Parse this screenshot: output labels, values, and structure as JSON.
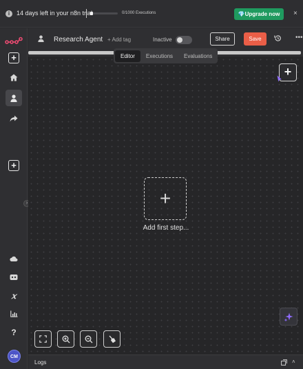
{
  "banner": {
    "trial_text": "14 days left in your n8n trial",
    "executions_text": "0/1000 Executions",
    "executions_used": 0,
    "executions_limit": 1000,
    "upgrade_label": "💎Upgrade now",
    "info_glyph": "i",
    "close_glyph": "×"
  },
  "header": {
    "workflow_name": "Research Agent",
    "add_tag_label": "+ Add tag",
    "active_label": "Inactive",
    "active": false,
    "share_label": "Share",
    "save_label": "Save",
    "more_glyph": "•••"
  },
  "tabs": [
    {
      "label": "Editor",
      "active": true
    },
    {
      "label": "Executions",
      "active": false
    },
    {
      "label": "Evaluations",
      "active": false
    }
  ],
  "canvas": {
    "add_node_glyph": "+",
    "first_step_glyph": "+",
    "first_step_label": "Add first step..."
  },
  "sidebar": {
    "items": [
      {
        "name": "n8n-logo-icon"
      },
      {
        "name": "create-icon"
      },
      {
        "name": "home-icon"
      },
      {
        "name": "personal-icon",
        "active": true
      },
      {
        "name": "shared-icon"
      },
      {
        "name": "add-project-icon"
      },
      {
        "name": "cloud-icon"
      },
      {
        "name": "templates-icon"
      },
      {
        "name": "variables-icon"
      },
      {
        "name": "insights-icon"
      },
      {
        "name": "help-icon"
      }
    ],
    "avatar_initials": "CM",
    "collapse_glyph": "›",
    "help_glyph": "?",
    "variables_glyph": "𝑥"
  },
  "logs": {
    "label": "Logs",
    "expand_glyph": "˄"
  },
  "colors": {
    "accent_save": "#ea5e47",
    "upgrade_green": "#1f9a5f",
    "logo_orange": "#ea4b71",
    "avatar_bg": "#4d55c7",
    "ai_purple": "#8f6bff"
  }
}
